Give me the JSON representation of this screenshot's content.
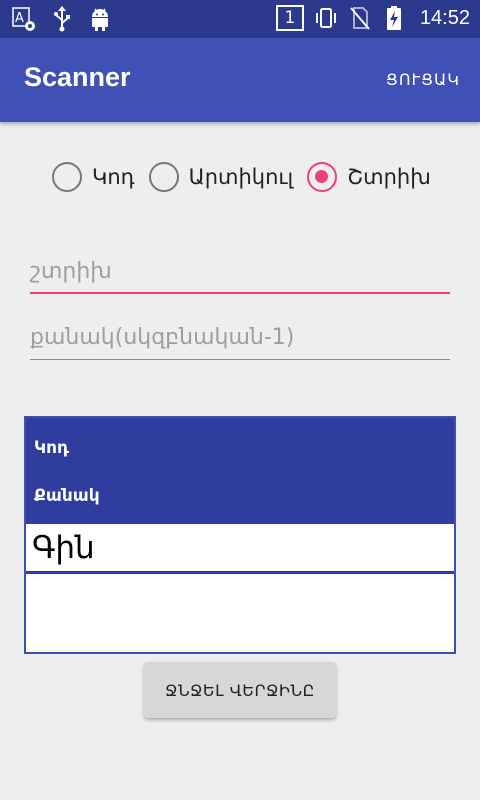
{
  "status_bar": {
    "left_icons": [
      "translate-settings-icon",
      "usb-icon",
      "android-icon"
    ],
    "sim_slot": "1",
    "right_icons": [
      "vibrate-icon",
      "no-sim-icon",
      "battery-charging-icon"
    ],
    "time": "14:52"
  },
  "app_bar": {
    "title": "Scanner",
    "action_label": "ՑՈՒՑԱԿ"
  },
  "radio_group": {
    "options": [
      {
        "label": "Կոդ",
        "checked": false
      },
      {
        "label": "Արտիկուլ",
        "checked": false
      },
      {
        "label": "Շտրիխ",
        "checked": true
      }
    ]
  },
  "inputs": {
    "barcode": {
      "placeholder": "շտրիխ",
      "value": ""
    },
    "quantity": {
      "placeholder": "քանակ(սկզբնական-1)",
      "value": ""
    }
  },
  "result_table": {
    "code_label": "Կոդ",
    "quantity_label": "Քանակ",
    "price_label": "Գին"
  },
  "delete_button": {
    "label": "ՋՆՋԵԼ ՎԵՐՋԻՆԸ"
  },
  "colors": {
    "status_bar": "#2b3a8c",
    "app_bar": "#3f51b5",
    "accent": "#ec407a",
    "table_header": "#2f3e9e"
  }
}
